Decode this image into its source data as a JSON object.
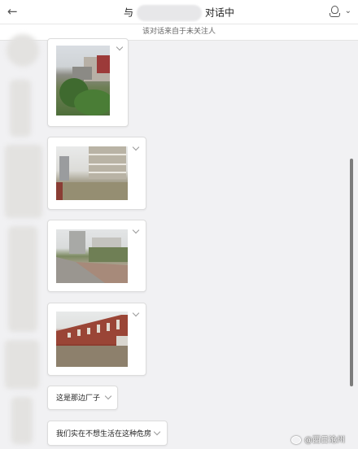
{
  "header": {
    "back_icon": "arrow-left-icon",
    "title_prefix": "与",
    "title_suffix": "对话中",
    "user_icon": "person-icon",
    "menu_icon": "chevron-down-icon"
  },
  "notice": "该对话来自于未关注人",
  "messages": [
    {
      "type": "image",
      "icon": "chevron-down-icon"
    },
    {
      "type": "image",
      "icon": "chevron-down-icon"
    },
    {
      "type": "image",
      "icon": "chevron-down-icon"
    },
    {
      "type": "image",
      "icon": "chevron-down-icon"
    },
    {
      "type": "text",
      "text": "这是那边厂子"
    },
    {
      "type": "text",
      "text": "我们实在不想生活在这种危房"
    }
  ],
  "watermark": "@西日沧州"
}
